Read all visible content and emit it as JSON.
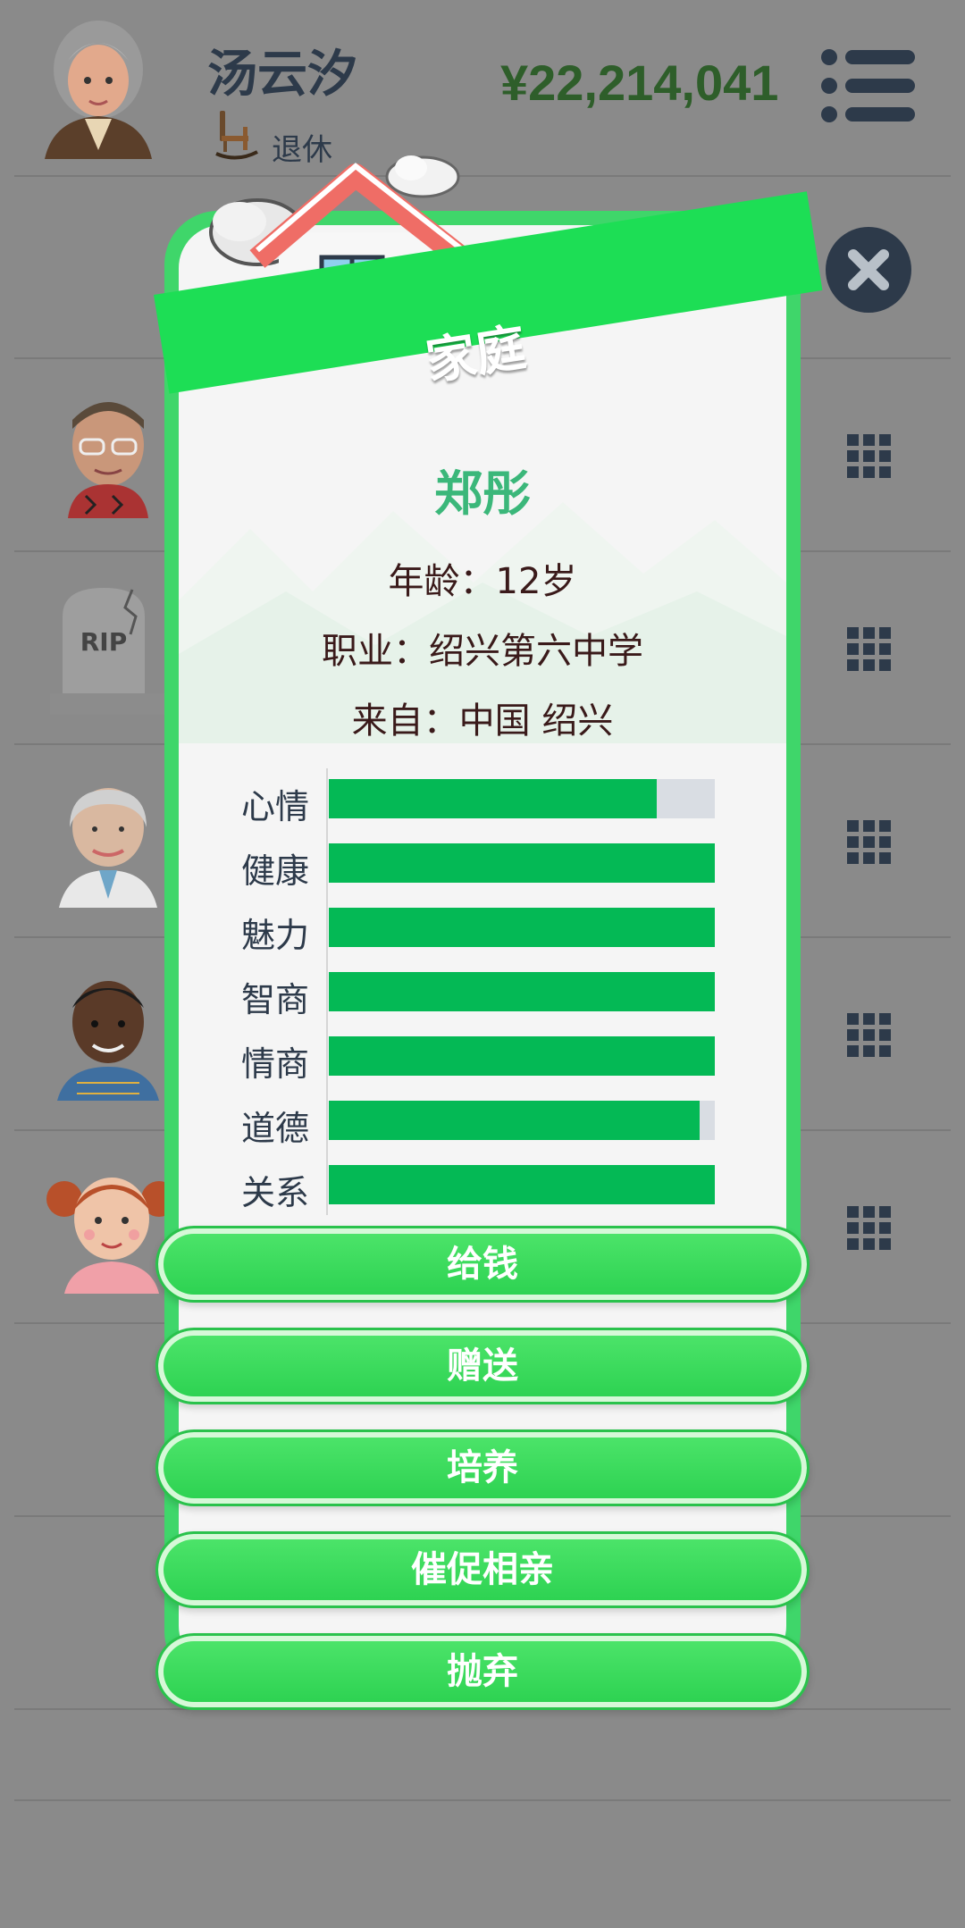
{
  "header": {
    "player_name": "汤云汐",
    "status": "退休",
    "money": "¥22,214,041"
  },
  "modal": {
    "title": "家庭",
    "child": {
      "name": "郑彤",
      "age_line": "年龄：12岁",
      "job_line": "职业：绍兴第六中学",
      "from_line": "来自：中国 绍兴"
    },
    "stats": [
      {
        "label": "心情",
        "value": 0.85
      },
      {
        "label": "健康",
        "value": 1.0
      },
      {
        "label": "魅力",
        "value": 1.0
      },
      {
        "label": "智商",
        "value": 1.0
      },
      {
        "label": "情商",
        "value": 1.0
      },
      {
        "label": "道德",
        "value": 0.96
      },
      {
        "label": "关系",
        "value": 1.0
      }
    ],
    "actions": [
      "给钱",
      "赠送",
      "培养",
      "催促相亲",
      "抛弃"
    ]
  },
  "background_rows": {
    "tombstone_text": "RIP"
  },
  "colors": {
    "accent_green": "#1dde55",
    "bar_fill": "#04b955",
    "bar_track": "#d9dde3",
    "name_green": "#3bb77a",
    "money_green": "#2e5e2a"
  },
  "icons": {
    "menu": "hamburger-icon",
    "close": "close-icon",
    "row_action": "grid-icon",
    "status": "rocking-chair-icon"
  }
}
